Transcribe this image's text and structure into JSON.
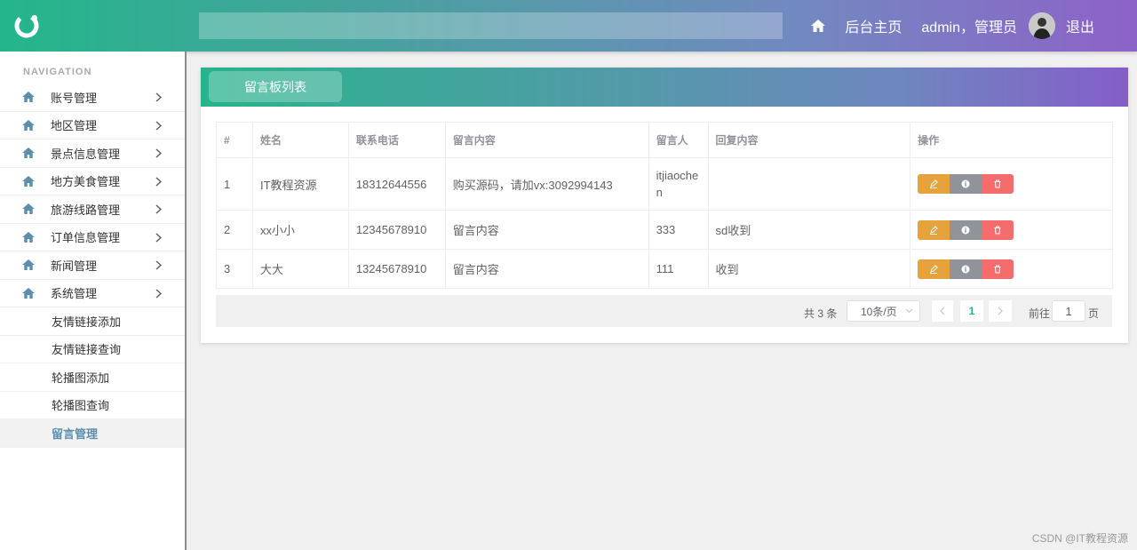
{
  "header": {
    "home_label": "后台主页",
    "user_label": "admin，管理员",
    "logout_label": "退出"
  },
  "sidebar": {
    "nav_title": "NAVIGATION",
    "items": [
      {
        "label": "账号管理"
      },
      {
        "label": "地区管理"
      },
      {
        "label": "景点信息管理"
      },
      {
        "label": "地方美食管理"
      },
      {
        "label": "旅游线路管理"
      },
      {
        "label": "订单信息管理"
      },
      {
        "label": "新闻管理"
      },
      {
        "label": "系统管理"
      }
    ],
    "sub_items": [
      {
        "label": "友情链接添加"
      },
      {
        "label": "友情链接查询"
      },
      {
        "label": "轮播图添加"
      },
      {
        "label": "轮播图查询"
      },
      {
        "label": "留言管理"
      }
    ]
  },
  "panel": {
    "title": "留言板列表"
  },
  "table": {
    "headers": [
      "#",
      "姓名",
      "联系电话",
      "留言内容",
      "留言人",
      "回复内容",
      "操作"
    ],
    "rows": [
      {
        "index": "1",
        "name": "IT教程资源",
        "phone": "18312644556",
        "content": "购买源码，请加vx:3092994143",
        "author": "itjiaochen",
        "reply": ""
      },
      {
        "index": "2",
        "name": "xx小小",
        "phone": "12345678910",
        "content": "留言内容",
        "author": "333",
        "reply": "sd收到"
      },
      {
        "index": "3",
        "name": "大大",
        "phone": "13245678910",
        "content": "留言内容",
        "author": "111",
        "reply": "收到"
      }
    ]
  },
  "pagination": {
    "total": "共 3 条",
    "page_size": "10条/页",
    "current": "1",
    "goto_label": "前往",
    "goto_value": "1",
    "unit": "页"
  },
  "watermark": "CSDN @IT教程资源",
  "colors": {
    "accent": "#24b68b",
    "edit": "#e6a23c",
    "info": "#909399",
    "delete": "#f56c6c"
  }
}
